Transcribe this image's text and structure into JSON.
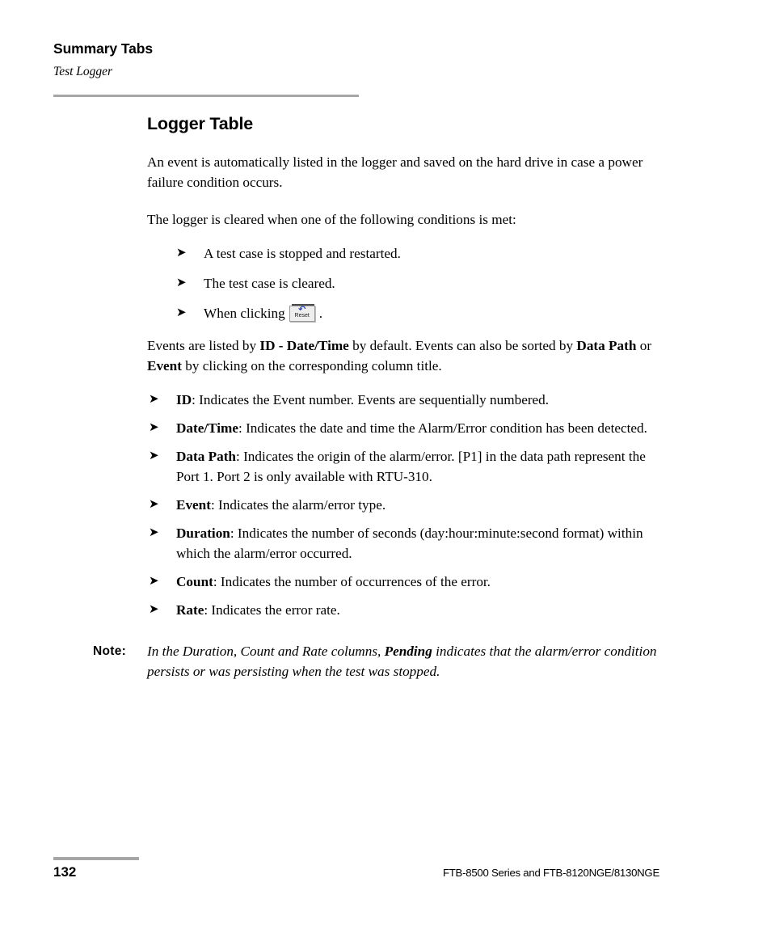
{
  "header": {
    "title": "Summary Tabs",
    "subtitle": "Test Logger"
  },
  "main": {
    "section_title": "Logger Table",
    "intro_paragraph": "An event is automatically listed in the logger and saved on the hard drive in case a power failure condition occurs.",
    "cleared_intro": "The logger is cleared when one of the following conditions is met:",
    "clear_conditions": [
      {
        "text": "A test case is stopped and restarted."
      },
      {
        "text": "The test case is cleared."
      },
      {
        "text_before": "When clicking",
        "button": "Reset",
        "text_after": "."
      }
    ],
    "sorting_paragraph": {
      "part1": "Events are listed by ",
      "bold1": "ID - Date/Time",
      "part2": " by default. Events can also be sorted by ",
      "bold2": "Data Path",
      "part3": " or ",
      "bold3": "Event",
      "part4": " by clicking on the corresponding column title."
    },
    "column_definitions": [
      {
        "term": "ID",
        "definition": ": Indicates the Event number. Events are sequentially numbered."
      },
      {
        "term": "Date/Time",
        "definition": ": Indicates the date and time the Alarm/Error condition has been detected."
      },
      {
        "term": "Data Path",
        "definition": ": Indicates the origin of the alarm/error. [P1] in the data path represent the Port 1. Port 2 is only available with RTU-310."
      },
      {
        "term": "Event",
        "definition": ": Indicates the alarm/error type."
      },
      {
        "term": "Duration",
        "definition": ": Indicates the number of seconds (day:hour:minute:second format) within which the alarm/error occurred."
      },
      {
        "term": "Count",
        "definition": ": Indicates the number of occurrences of the error."
      },
      {
        "term": "Rate",
        "definition": ": Indicates the error rate."
      }
    ],
    "note": {
      "label": "Note:",
      "part1": "In the Duration, Count and Rate columns, ",
      "bold": "Pending",
      "part2": " indicates that the alarm/error condition persists or was persisting when the test was stopped."
    }
  },
  "footer": {
    "page_number": "132",
    "document_title": "FTB-8500 Series and FTB-8120NGE/8130NGE"
  },
  "icons": {
    "bullet_arrow": "➤",
    "reset_undo": "↶"
  },
  "colors": {
    "rule_gray": "#a6a6a6",
    "reset_blue": "#2b44b8",
    "text": "#000000",
    "page_background": "#ffffff"
  }
}
